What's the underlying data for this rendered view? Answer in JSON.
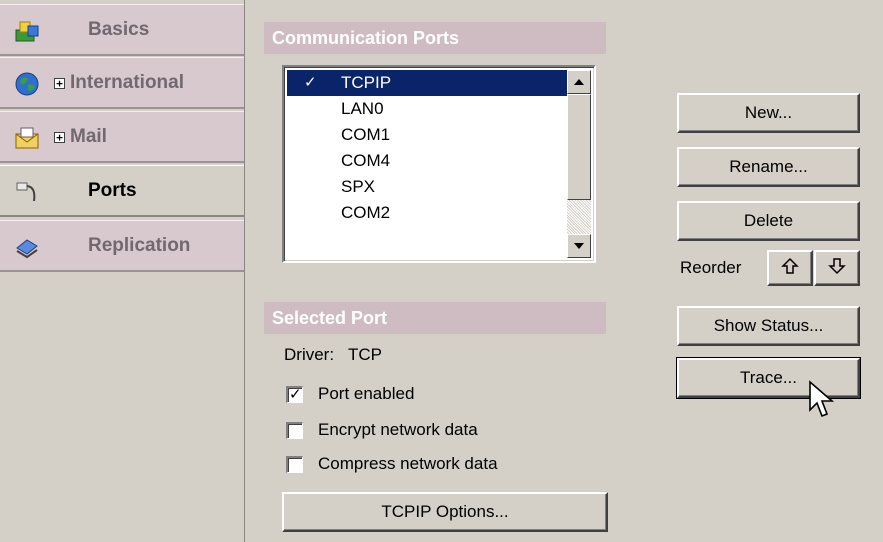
{
  "nav": {
    "items": [
      {
        "label": "Basics",
        "icon": "basics-icon",
        "expandable": false,
        "active": false
      },
      {
        "label": "International",
        "icon": "globe-icon",
        "expandable": true,
        "active": false
      },
      {
        "label": "Mail",
        "icon": "mail-icon",
        "expandable": true,
        "active": false
      },
      {
        "label": "Ports",
        "icon": "ports-icon",
        "expandable": false,
        "active": true
      },
      {
        "label": "Replication",
        "icon": "replication-icon",
        "expandable": false,
        "active": false
      }
    ]
  },
  "ports_section": {
    "title": "Communication Ports",
    "ports": [
      "TCPIP",
      "LAN0",
      "COM1",
      "COM4",
      "SPX",
      "COM2"
    ],
    "selected_index": 0
  },
  "selected_port": {
    "title": "Selected Port",
    "driver_label": "Driver:",
    "driver_value": "TCP",
    "options": [
      {
        "label": "Port enabled",
        "checked": true
      },
      {
        "label": "Encrypt network data",
        "checked": false
      },
      {
        "label": "Compress network data",
        "checked": false
      }
    ],
    "options_button": "TCPIP Options..."
  },
  "actions": {
    "new": "New...",
    "rename": "Rename...",
    "delete": "Delete",
    "reorder_label": "Reorder",
    "show_status": "Show Status...",
    "trace": "Trace..."
  },
  "colors": {
    "selection": "#0a246a",
    "section_header": "#cfbcc2",
    "nav_inactive": "#d7c9cd"
  }
}
